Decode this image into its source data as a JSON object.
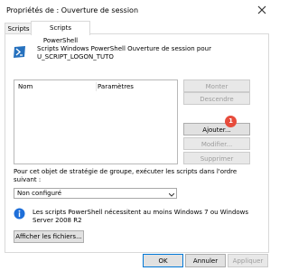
{
  "window": {
    "title": "Propriétés de : Ouverture de session",
    "close_glyph": "✕"
  },
  "tabs": [
    {
      "label": "Scripts"
    },
    {
      "label": "Scripts PowerShell"
    }
  ],
  "header": {
    "line1": "Scripts Windows PowerShell Ouverture de session pour",
    "line2": "U_SCRIPT_LOGON_TUTO"
  },
  "list": {
    "columns": [
      "Nom",
      "Paramètres"
    ]
  },
  "side_buttons": {
    "up": "Monter",
    "down": "Descendre",
    "add": "Ajouter...",
    "edit": "Modifier...",
    "remove": "Supprimer"
  },
  "badge": "1",
  "order": {
    "label": "Pour cet objet de stratégie de groupe, exécuter les scripts dans l'ordre suivant :",
    "selected": "Non configuré"
  },
  "info": {
    "text": "Les scripts PowerShell nécessitent au moins Windows 7 ou Windows Server 2008 R2"
  },
  "view_files_button": "Afficher les fichiers...",
  "footer": {
    "ok": "OK",
    "cancel": "Annuler",
    "apply": "Appliquer"
  },
  "colors": {
    "accent": "#0078d7",
    "badge": "#e74c3c"
  },
  "icons": [
    "powershell-icon",
    "info-icon",
    "close-icon",
    "chevron-down-icon"
  ]
}
